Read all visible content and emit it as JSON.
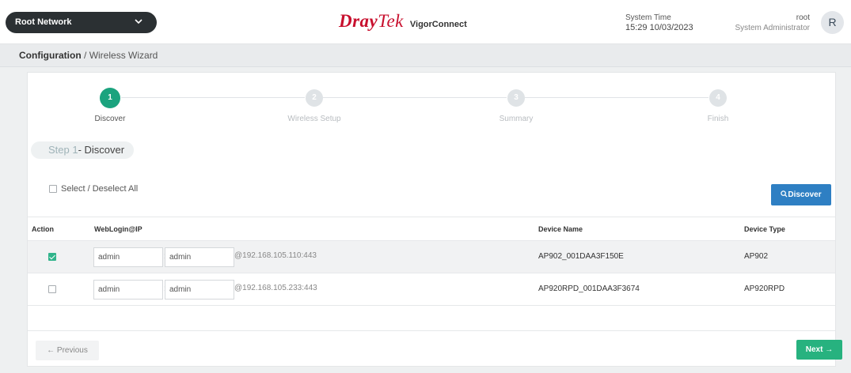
{
  "header": {
    "network_label": "Root Network",
    "brand_logo_dray": "Dray",
    "brand_logo_tek": "Tek",
    "brand_product": "VigorConnect",
    "system_time_label": "System Time",
    "system_time_value": "15:29 10/03/2023",
    "user_name": "root",
    "user_role": "System Administrator",
    "avatar_initial": "R"
  },
  "breadcrumb": {
    "root": "Configuration",
    "separator": "/",
    "current": "Wireless Wizard"
  },
  "stepper": {
    "steps": [
      {
        "number": "1",
        "label": "Discover",
        "active": true
      },
      {
        "number": "2",
        "label": "Wireless Setup",
        "active": false
      },
      {
        "number": "3",
        "label": "Summary",
        "active": false
      },
      {
        "number": "4",
        "label": "Finish",
        "active": false
      }
    ]
  },
  "step_title": {
    "prefix": "Step 1",
    "suffix": "- Discover"
  },
  "select_all_label": "Select / Deselect All",
  "discover_button_label": "Discover",
  "table": {
    "columns": [
      "Action",
      "WebLogin@IP",
      "Device Name",
      "Device Type"
    ],
    "rows": [
      {
        "checked": true,
        "username": "admin",
        "password": "admin",
        "ip": "@192.168.105.110:443",
        "device_name": "AP902_001DAA3F150E",
        "device_type": "AP902"
      },
      {
        "checked": false,
        "username": "admin",
        "password": "admin",
        "ip": "@192.168.105.233:443",
        "device_name": "AP920RPD_001DAA3F3674",
        "device_type": "AP920RPD"
      }
    ]
  },
  "footer": {
    "previous_label": "← Previous",
    "next_label": "Next →"
  },
  "colors": {
    "accent_green": "#1ba37e",
    "discover_blue": "#2e7fc3",
    "brand_red": "#c8102e"
  }
}
